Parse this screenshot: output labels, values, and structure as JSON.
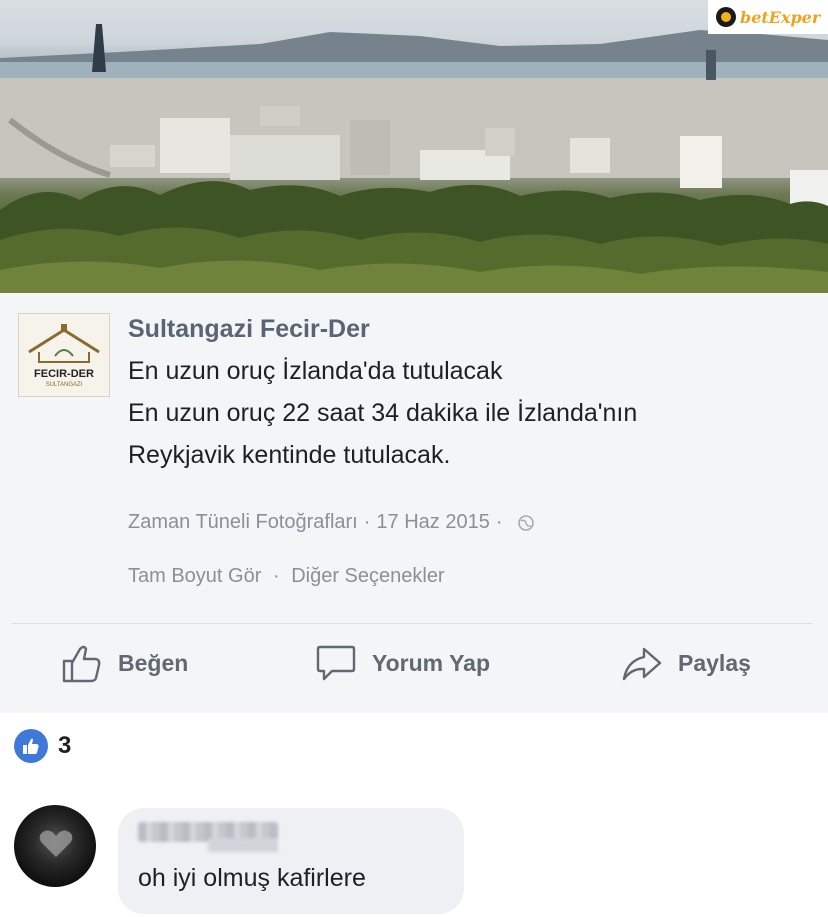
{
  "watermark": {
    "text": "betExper"
  },
  "post": {
    "page_avatar": {
      "brand": "FECIR-DER",
      "brand_sub": "SULTANGAZI"
    },
    "page_name": "Sultangazi Fecir-Der",
    "lines": [
      "En uzun oruç İzlanda'da tutulacak",
      "En uzun oruç 22 saat 34 dakika ile İzlanda'nın",
      "Reykjavik kentinde tutulacak."
    ],
    "meta": {
      "album": "Zaman Tüneli Fotoğrafları",
      "date": "17 Haz 2015",
      "privacy_icon": "globe-icon"
    },
    "options": {
      "full_size": "Tam Boyut Gör",
      "other": "Diğer Seçenekler"
    },
    "actions": {
      "like": "Beğen",
      "comment": "Yorum Yap",
      "share": "Paylaş"
    }
  },
  "reactions": {
    "count": "3",
    "icon": "like-icon",
    "color": "#3f79d8"
  },
  "comment": {
    "text": "oh iyi olmuş kafirlere"
  }
}
